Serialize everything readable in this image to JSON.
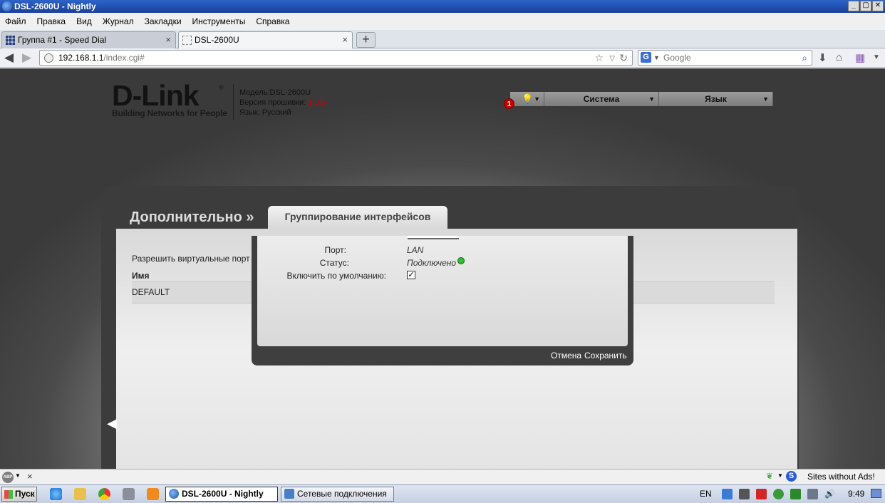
{
  "window": {
    "title": "DSL-2600U - Nightly",
    "buttons": [
      "_",
      "▢",
      "✕"
    ]
  },
  "menubar": {
    "items": [
      "Файл",
      "Правка",
      "Вид",
      "Журнал",
      "Закладки",
      "Инструменты",
      "Справка"
    ]
  },
  "tabs": [
    {
      "label": "Группа #1 - Speed Dial",
      "close": "×"
    },
    {
      "label": "DSL-2600U",
      "close": "×"
    }
  ],
  "newtab_label": "+",
  "navbar": {
    "url_host": "192.168.1.1",
    "url_path": "/index.cgi#",
    "search_placeholder": "Google",
    "search_engine_icon": "G"
  },
  "router": {
    "logo_text": "D-Link",
    "logo_reg": "®",
    "logo_tagline": "Building Networks for People",
    "model_label": "Модель:",
    "model_value": "DSL-2600U",
    "firmware_label": "Версия прошивки:",
    "firmware_value": "1.0.5",
    "language_label": "Язык:",
    "language_value": "Русский",
    "notification_count": "1",
    "menu_system": "Система",
    "menu_language": "Язык",
    "section_title": "Дополнительно »",
    "subtab_title": "Группирование интерфейсов",
    "allow_virtual_ports": "Разрешить виртуальные порт",
    "table_header_name": "Имя",
    "table_row_default": "DEFAULT"
  },
  "modal": {
    "port_label": "Порт:",
    "port_value": "LAN",
    "status_label": "Статус:",
    "status_value": "Подключено",
    "default_label": "Включить по умолчанию:",
    "default_checked": true,
    "cancel_label": "Отмена",
    "save_label": "Сохранить"
  },
  "addonbar": {
    "abp_label": "ABP",
    "close": "×",
    "s_label": "S",
    "sites_text": "Sites without Ads!"
  },
  "taskbar": {
    "start_label": "Пуск",
    "items": [
      {
        "label": "DSL-2600U - Nightly",
        "active": true
      },
      {
        "label": "Сетевые подключения",
        "active": false
      }
    ],
    "lang": "EN",
    "time": "9:49"
  },
  "colors": {
    "accent_red": "#c80000",
    "status_green": "#2fbf2f",
    "titlebar_blue": "#2d63c8"
  }
}
